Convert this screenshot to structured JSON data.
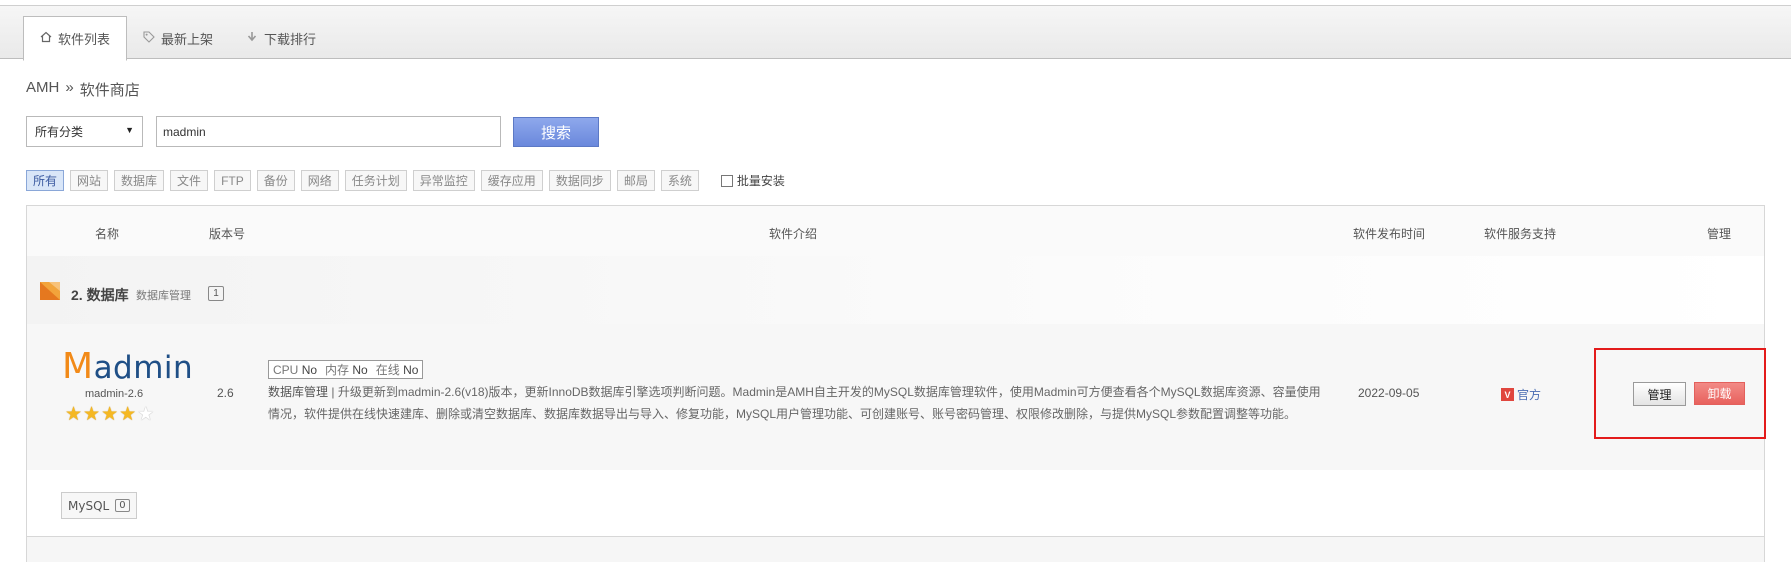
{
  "tabs": [
    {
      "label": "软件列表",
      "icon": "home-icon",
      "active": true
    },
    {
      "label": "最新上架",
      "icon": "tag-icon",
      "active": false
    },
    {
      "label": "下载排行",
      "icon": "arrow-down-icon",
      "active": false
    }
  ],
  "breadcrumb": {
    "root": "AMH",
    "sep": "»",
    "current": "软件商店"
  },
  "search": {
    "category": "所有分类",
    "query": "madmin",
    "button": "搜索"
  },
  "filters": [
    "所有",
    "网站",
    "数据库",
    "文件",
    "FTP",
    "备份",
    "网络",
    "任务计划",
    "异常监控",
    "缓存应用",
    "数据同步",
    "邮局",
    "系统"
  ],
  "batch_install": "批量安装",
  "table": {
    "headers": {
      "name": "名称",
      "version": "版本号",
      "intro": "软件介绍",
      "date": "软件发布时间",
      "support": "软件服务支持",
      "manage": "管理"
    }
  },
  "category": {
    "title": "2. 数据库",
    "subtitle": "数据库管理",
    "count": "1"
  },
  "item": {
    "logo_first": "M",
    "logo_rest": "admin",
    "name": "madmin-2.6",
    "rating": 4,
    "version": "2.6",
    "specs": {
      "cpu_label": "CPU",
      "cpu": "No",
      "mem_label": "内存",
      "mem": "No",
      "online_label": "在线",
      "online": "No"
    },
    "desc_lead": "数据库管理",
    "desc_sep": "|",
    "description": "升级更新到madmin-2.6(v18)版本，更新InnoDB数据库引擎选项判断问题。Madmin是AMH自主开发的MySQL数据库管理软件，使用Madmin可方便查看各个MySQL数据库资源、容量使用情况，软件提供在线快速建库、删除或清空数据库、数据库数据导出与导入、修复功能，MySQL用户管理功能、可创建账号、账号密码管理、权限修改删除，与提供MySQL参数配置调整等功能。",
    "date": "2022-09-05",
    "support_badge": "V",
    "support": "官方",
    "manage_btn": "管理",
    "uninstall_btn": "卸载"
  },
  "tag": {
    "label": "MySQL",
    "count": "0"
  },
  "colors": {
    "accent": "#6a88dc",
    "uninstall": "#e8625d",
    "highlight_box": "#e31b1b",
    "star": "#f5b822"
  }
}
